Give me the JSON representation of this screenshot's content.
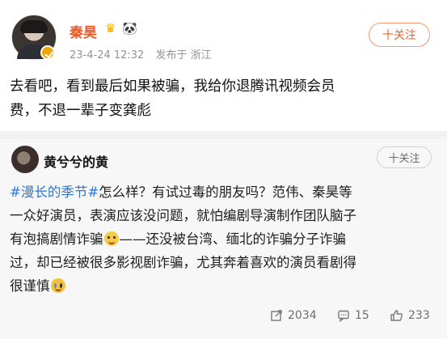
{
  "post": {
    "author": "秦昊",
    "timestamp": "23-4-24 12:32",
    "source": "发布于 浙江",
    "follow_label": "十关注",
    "content_line1": "去看吧，看到最后如果被骗，我给你退腾讯视频会员",
    "content_line2": "费，不退一辈子变龚彪"
  },
  "repost": {
    "author": "黄兮兮的黄",
    "follow_label": "十关注",
    "topic": "#漫长的季节#",
    "line1_rest": "怎么样？有试过毒的朋友吗？范伟、秦昊等",
    "line2": "一众好演员，表演应该没问题，就怕编剧导演制作团队脑子",
    "line3_start": "有泡搞剧情诈骗",
    "line3_end": "——还没被台湾、缅北的诈骗分子诈骗",
    "line4": "过，却已经被很多影视剧诈骗，尤其奔着喜欢的演员看剧得",
    "line5": "很谨慎"
  },
  "actions": {
    "share_count": "2034",
    "comment_count": "15",
    "like_count": "233"
  },
  "icons": [
    "verified-icon",
    "crown-icon",
    "panda-icon",
    "share-icon",
    "comment-icon",
    "like-icon",
    "laugh-cry-emoji",
    "cry-emoji"
  ],
  "colors": {
    "name": "#e95a2b",
    "topic": "#2a78d6",
    "follow_border": "#f19b6e"
  }
}
